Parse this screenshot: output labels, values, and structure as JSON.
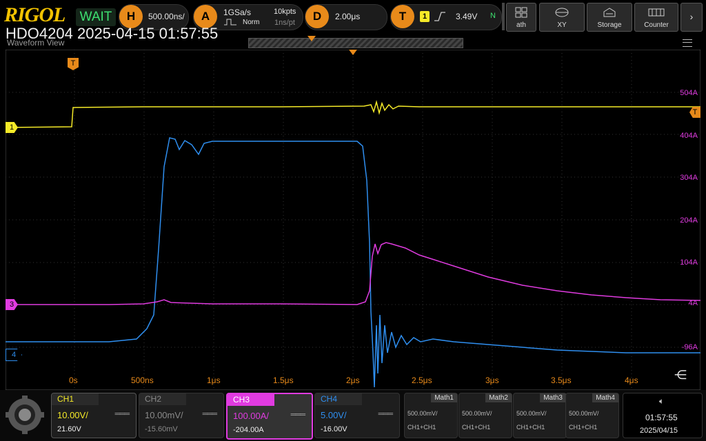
{
  "brand": "RIGOL",
  "status": "WAIT",
  "timebase": {
    "badge": "H",
    "value": "500.00ns/"
  },
  "acquire": {
    "badge": "A",
    "rate": "1GSa/s",
    "mode": "Norm",
    "points": "10kpts",
    "interval": "1ns/pt"
  },
  "delay": {
    "badge": "D",
    "value": "2.00μs"
  },
  "trigger": {
    "badge": "T",
    "source": "1",
    "level": "3.49V",
    "state": "N"
  },
  "right_buttons": [
    {
      "label": "ath",
      "icon": "math-icon"
    },
    {
      "label": "XY",
      "icon": "xy-icon"
    },
    {
      "label": "Storage",
      "icon": "storage-icon"
    },
    {
      "label": "Counter",
      "icon": "counter-icon"
    }
  ],
  "info": {
    "model": "HDO4204",
    "datetime": "2025-04-15 01:57:55"
  },
  "view_title": "Waveform View",
  "ch3_scale_labels": [
    "504A",
    "404A",
    "304A",
    "204A",
    "104A",
    "4A",
    "-96A"
  ],
  "x_labels": [
    "0s",
    "500ns",
    "1μs",
    "1.5μs",
    "2μs",
    "2.5μs",
    "3μs",
    "3.5μs",
    "4μs"
  ],
  "markers": {
    "ch1": "1",
    "ch3": "3",
    "ch4": "4",
    "trigger": "T"
  },
  "channels": [
    {
      "name": "CH1",
      "scale": "10.00V/",
      "offset": "21.60V",
      "color": "#f5ea28",
      "active": true
    },
    {
      "name": "CH2",
      "scale": "10.00mV/",
      "offset": "-15.60mV",
      "color": "#8a8a8a",
      "active": false
    },
    {
      "name": "CH3",
      "scale": "100.00A/",
      "offset": "-204.00A",
      "color": "#e03be0",
      "active": true
    },
    {
      "name": "CH4",
      "scale": "5.00V/",
      "offset": "-16.00V",
      "color": "#2f8ff0",
      "active": true
    }
  ],
  "math": [
    {
      "name": "Math1",
      "scale": "500.00mV/",
      "formula": "CH1+CH1"
    },
    {
      "name": "Math2",
      "scale": "500.00mV/",
      "formula": "CH1+CH1"
    },
    {
      "name": "Math3",
      "scale": "500.00mV/",
      "formula": "CH1+CH1"
    },
    {
      "name": "Math4",
      "scale": "500.00mV/",
      "formula": "CH1+CH1"
    }
  ],
  "clock": {
    "time": "01:57:55",
    "date": "2025/04/15"
  },
  "colors": {
    "ch1": "#f5ea28",
    "ch3": "#e03be0",
    "ch4": "#2f8ff0",
    "accent": "#e88a1a",
    "status": "#3de070"
  }
}
